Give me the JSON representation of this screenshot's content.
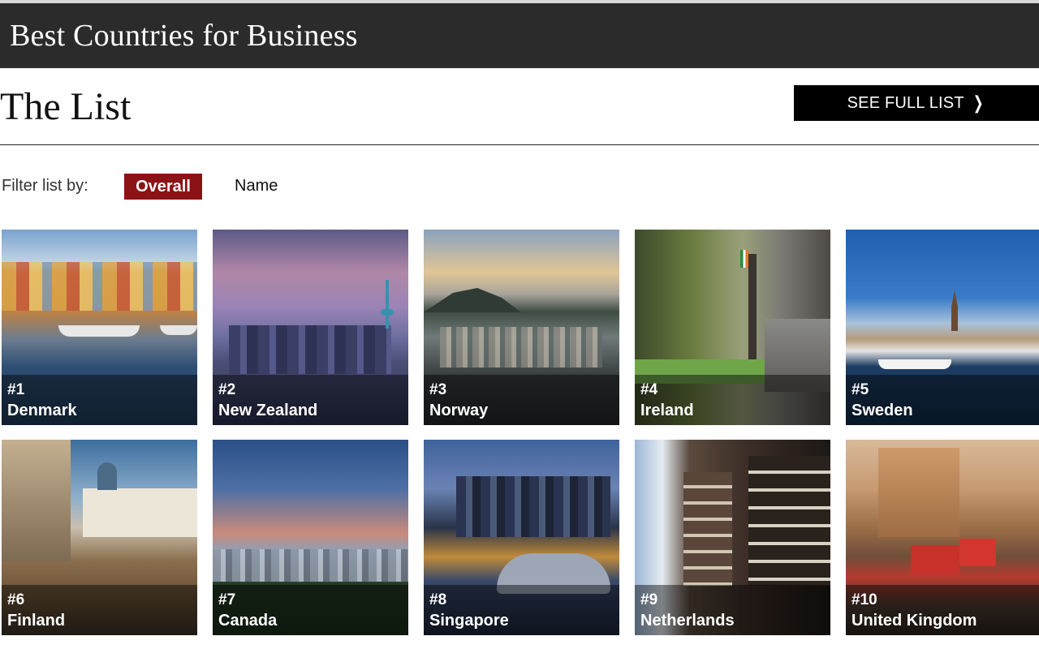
{
  "header": {
    "title": "Best Countries for Business"
  },
  "list": {
    "title": "The List",
    "see_full_label": "SEE FULL LIST",
    "see_full_icon": "chevron-right-icon"
  },
  "filter": {
    "label": "Filter list by:",
    "overall": "Overall",
    "name": "Name",
    "active_color": "#8b1216"
  },
  "countries": [
    {
      "rank": "#1",
      "name": "Denmark"
    },
    {
      "rank": "#2",
      "name": "New Zealand"
    },
    {
      "rank": "#3",
      "name": "Norway"
    },
    {
      "rank": "#4",
      "name": "Ireland"
    },
    {
      "rank": "#5",
      "name": "Sweden"
    },
    {
      "rank": "#6",
      "name": "Finland"
    },
    {
      "rank": "#7",
      "name": "Canada"
    },
    {
      "rank": "#8",
      "name": "Singapore"
    },
    {
      "rank": "#9",
      "name": "Netherlands"
    },
    {
      "rank": "#10",
      "name": "United Kingdom"
    }
  ]
}
